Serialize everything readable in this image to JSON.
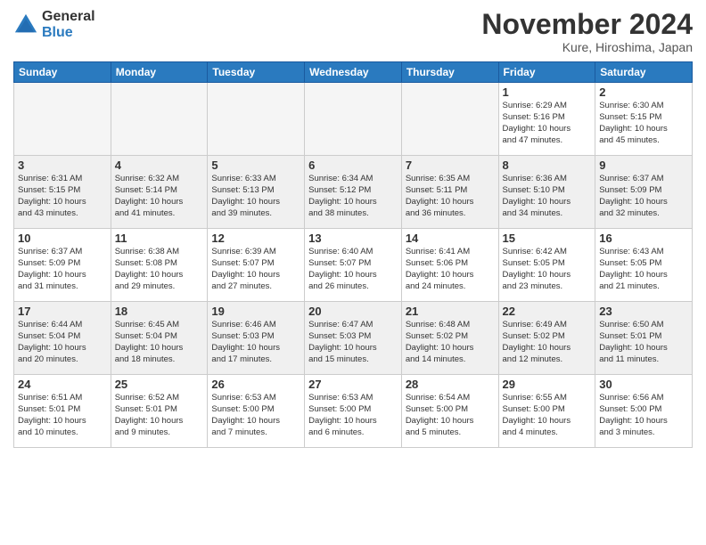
{
  "header": {
    "logo_general": "General",
    "logo_blue": "Blue",
    "month_title": "November 2024",
    "location": "Kure, Hiroshima, Japan"
  },
  "weekdays": [
    "Sunday",
    "Monday",
    "Tuesday",
    "Wednesday",
    "Thursday",
    "Friday",
    "Saturday"
  ],
  "weeks": [
    [
      {
        "day": "",
        "info": "",
        "empty": true
      },
      {
        "day": "",
        "info": "",
        "empty": true
      },
      {
        "day": "",
        "info": "",
        "empty": true
      },
      {
        "day": "",
        "info": "",
        "empty": true
      },
      {
        "day": "",
        "info": "",
        "empty": true
      },
      {
        "day": "1",
        "info": "Sunrise: 6:29 AM\nSunset: 5:16 PM\nDaylight: 10 hours\nand 47 minutes."
      },
      {
        "day": "2",
        "info": "Sunrise: 6:30 AM\nSunset: 5:15 PM\nDaylight: 10 hours\nand 45 minutes."
      }
    ],
    [
      {
        "day": "3",
        "info": "Sunrise: 6:31 AM\nSunset: 5:15 PM\nDaylight: 10 hours\nand 43 minutes."
      },
      {
        "day": "4",
        "info": "Sunrise: 6:32 AM\nSunset: 5:14 PM\nDaylight: 10 hours\nand 41 minutes."
      },
      {
        "day": "5",
        "info": "Sunrise: 6:33 AM\nSunset: 5:13 PM\nDaylight: 10 hours\nand 39 minutes."
      },
      {
        "day": "6",
        "info": "Sunrise: 6:34 AM\nSunset: 5:12 PM\nDaylight: 10 hours\nand 38 minutes."
      },
      {
        "day": "7",
        "info": "Sunrise: 6:35 AM\nSunset: 5:11 PM\nDaylight: 10 hours\nand 36 minutes."
      },
      {
        "day": "8",
        "info": "Sunrise: 6:36 AM\nSunset: 5:10 PM\nDaylight: 10 hours\nand 34 minutes."
      },
      {
        "day": "9",
        "info": "Sunrise: 6:37 AM\nSunset: 5:09 PM\nDaylight: 10 hours\nand 32 minutes."
      }
    ],
    [
      {
        "day": "10",
        "info": "Sunrise: 6:37 AM\nSunset: 5:09 PM\nDaylight: 10 hours\nand 31 minutes."
      },
      {
        "day": "11",
        "info": "Sunrise: 6:38 AM\nSunset: 5:08 PM\nDaylight: 10 hours\nand 29 minutes."
      },
      {
        "day": "12",
        "info": "Sunrise: 6:39 AM\nSunset: 5:07 PM\nDaylight: 10 hours\nand 27 minutes."
      },
      {
        "day": "13",
        "info": "Sunrise: 6:40 AM\nSunset: 5:07 PM\nDaylight: 10 hours\nand 26 minutes."
      },
      {
        "day": "14",
        "info": "Sunrise: 6:41 AM\nSunset: 5:06 PM\nDaylight: 10 hours\nand 24 minutes."
      },
      {
        "day": "15",
        "info": "Sunrise: 6:42 AM\nSunset: 5:05 PM\nDaylight: 10 hours\nand 23 minutes."
      },
      {
        "day": "16",
        "info": "Sunrise: 6:43 AM\nSunset: 5:05 PM\nDaylight: 10 hours\nand 21 minutes."
      }
    ],
    [
      {
        "day": "17",
        "info": "Sunrise: 6:44 AM\nSunset: 5:04 PM\nDaylight: 10 hours\nand 20 minutes."
      },
      {
        "day": "18",
        "info": "Sunrise: 6:45 AM\nSunset: 5:04 PM\nDaylight: 10 hours\nand 18 minutes."
      },
      {
        "day": "19",
        "info": "Sunrise: 6:46 AM\nSunset: 5:03 PM\nDaylight: 10 hours\nand 17 minutes."
      },
      {
        "day": "20",
        "info": "Sunrise: 6:47 AM\nSunset: 5:03 PM\nDaylight: 10 hours\nand 15 minutes."
      },
      {
        "day": "21",
        "info": "Sunrise: 6:48 AM\nSunset: 5:02 PM\nDaylight: 10 hours\nand 14 minutes."
      },
      {
        "day": "22",
        "info": "Sunrise: 6:49 AM\nSunset: 5:02 PM\nDaylight: 10 hours\nand 12 minutes."
      },
      {
        "day": "23",
        "info": "Sunrise: 6:50 AM\nSunset: 5:01 PM\nDaylight: 10 hours\nand 11 minutes."
      }
    ],
    [
      {
        "day": "24",
        "info": "Sunrise: 6:51 AM\nSunset: 5:01 PM\nDaylight: 10 hours\nand 10 minutes."
      },
      {
        "day": "25",
        "info": "Sunrise: 6:52 AM\nSunset: 5:01 PM\nDaylight: 10 hours\nand 9 minutes."
      },
      {
        "day": "26",
        "info": "Sunrise: 6:53 AM\nSunset: 5:00 PM\nDaylight: 10 hours\nand 7 minutes."
      },
      {
        "day": "27",
        "info": "Sunrise: 6:53 AM\nSunset: 5:00 PM\nDaylight: 10 hours\nand 6 minutes."
      },
      {
        "day": "28",
        "info": "Sunrise: 6:54 AM\nSunset: 5:00 PM\nDaylight: 10 hours\nand 5 minutes."
      },
      {
        "day": "29",
        "info": "Sunrise: 6:55 AM\nSunset: 5:00 PM\nDaylight: 10 hours\nand 4 minutes."
      },
      {
        "day": "30",
        "info": "Sunrise: 6:56 AM\nSunset: 5:00 PM\nDaylight: 10 hours\nand 3 minutes."
      }
    ]
  ]
}
